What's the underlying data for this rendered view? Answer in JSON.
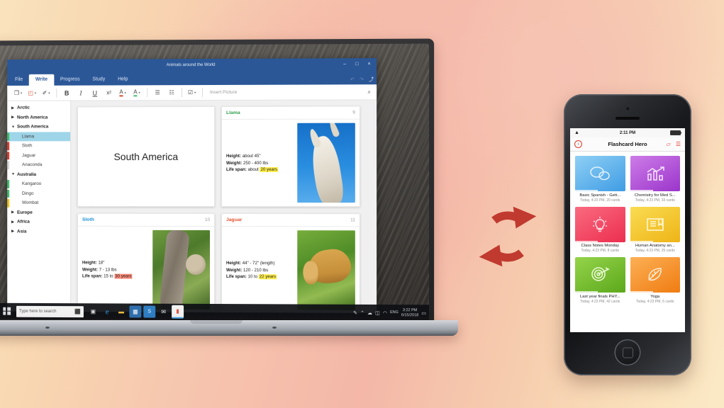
{
  "scene": {
    "background_colors": [
      "#f9e3bd",
      "#f6c3ae",
      "#f4b7a8",
      "#fbe9c6"
    ],
    "sync_icon_color": "#c03a30",
    "sync_icon_name": "sync-arrows-icon"
  },
  "laptop": {
    "app": {
      "title": "Animals around the World",
      "accent": "#2b5797",
      "window_buttons": [
        {
          "name": "minimize-button",
          "glyph": "–"
        },
        {
          "name": "maximize-button",
          "glyph": "□"
        },
        {
          "name": "close-button",
          "glyph": "×"
        }
      ],
      "tabs": [
        {
          "label": "File",
          "active": false
        },
        {
          "label": "Write",
          "active": true
        },
        {
          "label": "Progress",
          "active": false
        },
        {
          "label": "Study",
          "active": false
        },
        {
          "label": "Help",
          "active": false
        }
      ],
      "ribbon_right": [
        {
          "name": "undo-icon",
          "glyph": "↶"
        },
        {
          "name": "redo-icon",
          "glyph": "↷"
        },
        {
          "name": "share-icon",
          "glyph": "⤴"
        }
      ],
      "toolbar": {
        "buttons": [
          {
            "name": "paste-button",
            "glyph": "❐",
            "caret": true
          },
          {
            "name": "clear-formatting-button",
            "glyph": "◰",
            "caret": true
          },
          {
            "name": "format-painter-button",
            "glyph": "✐",
            "caret": true
          },
          {
            "name": "bold-button",
            "glyph": "B",
            "style": "bold"
          },
          {
            "name": "italic-button",
            "glyph": "I",
            "style": "ital"
          },
          {
            "name": "underline-button",
            "glyph": "U",
            "style": "und"
          },
          {
            "name": "superscript-button",
            "glyph": "x²"
          },
          {
            "name": "font-color-button",
            "glyph": "A",
            "caret": true
          },
          {
            "name": "highlight-color-button",
            "glyph": "A",
            "caret": true
          },
          {
            "name": "bulleted-list-button",
            "glyph": "☰"
          },
          {
            "name": "numbered-list-button",
            "glyph": "☷"
          },
          {
            "name": "checkbox-list-button",
            "glyph": "☑",
            "caret": true
          }
        ],
        "insert_picture_label": "Insert Picture",
        "search_icon": "search-icon"
      },
      "sidebar": {
        "nodes": [
          {
            "label": "Arctic",
            "type": "group",
            "expanded": false,
            "twisty": "▶"
          },
          {
            "label": "North America",
            "type": "group",
            "expanded": false,
            "twisty": "▶"
          },
          {
            "label": "South America",
            "type": "group",
            "expanded": true,
            "twisty": "▼"
          },
          {
            "label": "Llama",
            "type": "child",
            "selected": true,
            "bar": "#3fbf6f"
          },
          {
            "label": "Sloth",
            "type": "child",
            "selected": false,
            "bar": "#e03b2f"
          },
          {
            "label": "Jaguar",
            "type": "child",
            "selected": false,
            "bar": "#e03b2f"
          },
          {
            "label": "Anaconda",
            "type": "child",
            "selected": false,
            "bar": "#d8d8d8"
          },
          {
            "label": "Australia",
            "type": "group",
            "expanded": true,
            "twisty": "▼"
          },
          {
            "label": "Kangaroo",
            "type": "child",
            "selected": false,
            "bar": "#3fbf6f"
          },
          {
            "label": "Dingo",
            "type": "child",
            "selected": false,
            "bar": "#3fbf6f"
          },
          {
            "label": "Wombat",
            "type": "child",
            "selected": false,
            "bar": "#f0c419"
          },
          {
            "label": "Europe",
            "type": "group",
            "expanded": false,
            "twisty": "▶"
          },
          {
            "label": "Africa",
            "type": "group",
            "expanded": false,
            "twisty": "▶"
          },
          {
            "label": "Asia",
            "type": "group",
            "expanded": false,
            "twisty": "▶"
          }
        ]
      },
      "cards": {
        "title_card": {
          "text": "South America"
        },
        "items": [
          {
            "name": "Llama",
            "number": "9",
            "title_color": "#2d9e4a",
            "photo": "llama-photo",
            "facts": [
              {
                "label": "Height:",
                "value": "about 45\"",
                "highlight": "none"
              },
              {
                "label": "Weight:",
                "value": "250 - 400 lbs",
                "highlight": "none"
              },
              {
                "label": "Life span:",
                "value": "about ",
                "highlighted_text": "20 years",
                "highlight": "yellow"
              }
            ]
          },
          {
            "name": "Sloth",
            "number": "10",
            "title_color": "#1a8fd6",
            "photo": "sloth-photo",
            "facts": [
              {
                "label": "Height:",
                "value": "18\"",
                "highlight": "none"
              },
              {
                "label": "Weight:",
                "value": "7 - 13 lbs",
                "highlight": "none"
              },
              {
                "label": "Life span:",
                "value": "15 to ",
                "highlighted_text": "30 years",
                "highlight": "red"
              }
            ]
          },
          {
            "name": "Jaguar",
            "number": "11",
            "title_color": "#e8502a",
            "photo": "jaguar-photo",
            "facts": [
              {
                "label": "Height:",
                "value": "44\" - 72\" (length)",
                "highlight": "none"
              },
              {
                "label": "Weight:",
                "value": "120 - 210 lbs",
                "highlight": "none"
              },
              {
                "label": "Life span:",
                "value": "10 to ",
                "highlighted_text": "22 years",
                "highlight": "yellow"
              }
            ]
          }
        ]
      }
    },
    "taskbar": {
      "search_placeholder": "Type here to search",
      "mic_icon": "microphone-icon",
      "icons": [
        {
          "name": "task-view-icon",
          "glyph": "▣",
          "color": "#dcdcdc",
          "bg": "transparent",
          "active": false
        },
        {
          "name": "edge-browser-icon",
          "glyph": "e",
          "color": "#2f9ee0",
          "bg": "transparent",
          "active": false
        },
        {
          "name": "file-explorer-icon",
          "glyph": "▬",
          "color": "#f0c040",
          "bg": "transparent",
          "active": false
        },
        {
          "name": "microsoft-store-icon",
          "glyph": "▦",
          "color": "#e8e8e8",
          "bg": "#2f6fae",
          "active": false
        },
        {
          "name": "skype-icon",
          "glyph": "S",
          "color": "#e8e8e8",
          "bg": "#2f7fc4",
          "active": false
        },
        {
          "name": "mail-icon",
          "glyph": "✉",
          "color": "#f2f2f2",
          "bg": "transparent",
          "active": false
        },
        {
          "name": "flashcard-hero-app-icon",
          "glyph": "▮",
          "color": "#e24b3c",
          "bg": "#f2f2f2",
          "active": true
        }
      ],
      "tray": [
        {
          "name": "pen-tray-icon",
          "glyph": "✎"
        },
        {
          "name": "show-hidden-icons-icon",
          "glyph": "⌃"
        },
        {
          "name": "onedrive-tray-icon",
          "glyph": "☁"
        },
        {
          "name": "network-tray-icon",
          "glyph": "◫"
        },
        {
          "name": "volume-tray-icon",
          "glyph": "◠"
        },
        {
          "name": "input-language-indicator",
          "glyph": "ENG"
        }
      ],
      "clock_time": "3:22 PM",
      "clock_date": "6/15/2018",
      "action_center_icon": "notifications-icon"
    }
  },
  "phone": {
    "status": {
      "wifi_icon": "wifi-icon",
      "time": "2:11 PM",
      "battery_icon": "battery-icon"
    },
    "nav": {
      "title": "Flashcard Hero",
      "left_icon": {
        "name": "info-icon",
        "glyph": "i",
        "color": "#e2382c"
      },
      "right_icons": [
        {
          "name": "folder-icon",
          "glyph": "▱",
          "color": "#e2382c"
        },
        {
          "name": "list-view-icon",
          "glyph": "☰",
          "color": "#e2382c"
        }
      ]
    },
    "decks": [
      {
        "name": "Basic Spanish - Gett...",
        "meta": "Today, 4:23 PM, 20 cards",
        "color_a": "#7fc6f2",
        "color_b": "#4fa5e8",
        "icon": "speech-bubbles-icon",
        "icon_glyph": "◯"
      },
      {
        "name": "Chemistry for Med S...",
        "meta": "Today, 4:23 PM, 33 cards",
        "color_a": "#c46ce0",
        "color_b": "#a13fd0",
        "icon": "bar-chart-icon",
        "icon_glyph": "◫"
      },
      {
        "name": "Class Notes Monday",
        "meta": "Today, 4:23 PM, 8 cards",
        "color_a": "#f5566e",
        "color_b": "#ee3355",
        "icon": "lightbulb-icon",
        "icon_glyph": "●"
      },
      {
        "name": "Human Anatomy an...",
        "meta": "Today, 4:23 PM, 25 cards",
        "color_a": "#f7d23c",
        "color_b": "#eeb81c",
        "icon": "open-book-icon",
        "icon_glyph": "▭"
      },
      {
        "name": "Last year finals PHY...",
        "meta": "Today, 4:23 PM, 42 cards",
        "color_a": "#86c93c",
        "color_b": "#63af22",
        "icon": "target-icon",
        "icon_glyph": "◎"
      },
      {
        "name": "Yoga",
        "meta": "Today, 4:23 PM, 6 cards",
        "color_a": "#faa23c",
        "color_b": "#f2811a",
        "icon": "leaf-icon",
        "icon_glyph": "◖"
      }
    ]
  }
}
